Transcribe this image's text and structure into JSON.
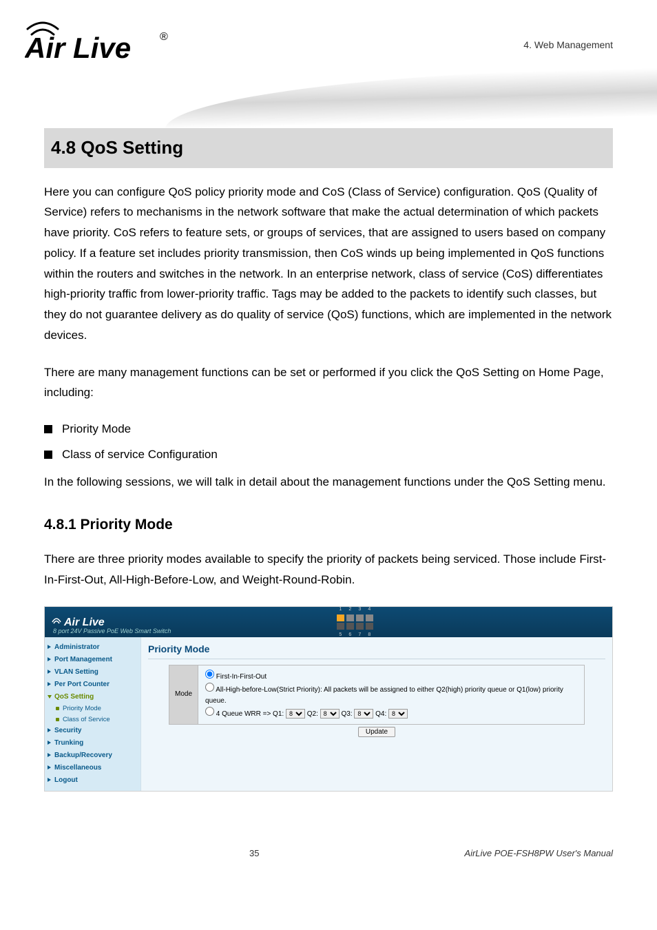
{
  "header": {
    "chapter": "4. Web Management",
    "logo_text": "Air Live",
    "logo_reg": "®"
  },
  "section": {
    "title": "4.8 QoS Setting",
    "p1": "Here you can configure QoS policy priority mode and CoS (Class of Service) configuration. QoS (Quality of Service) refers to mechanisms in the network software that make the actual determination of which packets have priority. CoS refers to feature sets, or groups of services, that are assigned to users based on company policy. If a feature set includes priority transmission, then CoS winds up being implemented in QoS functions within the routers and switches in the network. In an enterprise network, class of service (CoS) differentiates high-priority traffic from lower-priority traffic. Tags may be added to the packets to identify such classes, but they do not guarantee delivery as do quality of service (QoS) functions, which are implemented in the network devices.",
    "p2": "There are many management functions can be set or performed if you click the QoS Setting on Home Page, including:",
    "bullets": [
      "Priority Mode",
      "Class of service Configuration"
    ],
    "p3": "In the following sessions, we will talk in detail about the management functions under the QoS Setting menu."
  },
  "subsection": {
    "title": "4.8.1 Priority Mode",
    "p1": "There are three priority modes available to specify the priority of packets being serviced. Those include First-In-First-Out, All-High-Before-Low, and Weight-Round-Robin."
  },
  "app": {
    "logo": "Air Live",
    "subtitle": "8 port 24V Passive PoE Web Smart Switch",
    "ports_top": [
      "1",
      "2",
      "3",
      "4"
    ],
    "ports_bot": [
      "5",
      "6",
      "7",
      "8"
    ],
    "side": {
      "administrator": "Administrator",
      "port_management": "Port Management",
      "vlan_setting": "VLAN Setting",
      "per_port_counter": "Per Port Counter",
      "qos_setting": "QoS Setting",
      "priority_mode": "Priority Mode",
      "class_of_service": "Class of Service",
      "security": "Security",
      "trunking": "Trunking",
      "backup_recovery": "Backup/Recovery",
      "miscellaneous": "Miscellaneous",
      "logout": "Logout"
    },
    "main": {
      "heading": "Priority Mode",
      "mode_label": "Mode",
      "opt1": "First-In-First-Out",
      "opt2": "All-High-before-Low(Strict Priority): All packets will be assigned to either Q2(high) priority queue or Q1(low) priority queue.",
      "opt3_prefix": "4 Queue WRR =>   Q1:",
      "opt3_q2": " Q2:",
      "opt3_q3": " Q3:",
      "opt3_q4": " Q4:",
      "wrr_val": "8",
      "update": "Update"
    }
  },
  "footer": {
    "page": "35",
    "manual": "AirLive POE-FSH8PW User's Manual"
  }
}
